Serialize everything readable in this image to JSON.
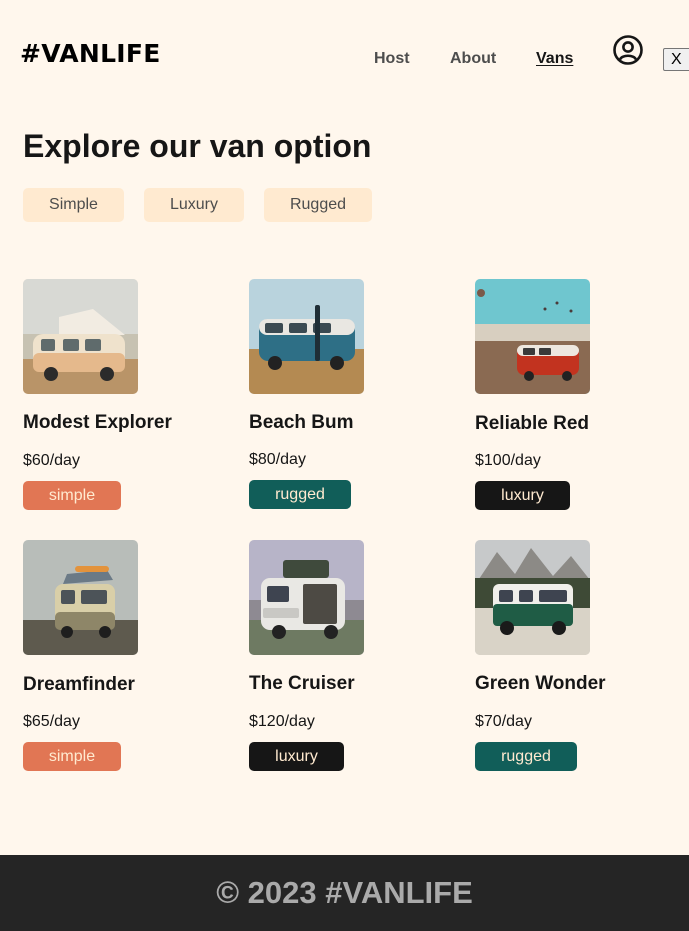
{
  "header": {
    "logo": "#VANLIFE",
    "nav": {
      "host": "Host",
      "about": "About",
      "vans": "Vans"
    },
    "close_label": "X"
  },
  "main": {
    "title": "Explore our van option",
    "filters": [
      "Simple",
      "Luxury",
      "Rugged"
    ],
    "vans": [
      {
        "name": "Modest Explorer",
        "price": "$60/day",
        "type": "simple"
      },
      {
        "name": "Beach Bum",
        "price": "$80/day",
        "type": "rugged"
      },
      {
        "name": "Reliable Red",
        "price": "$100/day",
        "type": "luxury"
      },
      {
        "name": "Dreamfinder",
        "price": "$65/day",
        "type": "simple"
      },
      {
        "name": "The Cruiser",
        "price": "$120/day",
        "type": "luxury"
      },
      {
        "name": "Green Wonder",
        "price": "$70/day",
        "type": "rugged"
      }
    ]
  },
  "footer": {
    "text": "© 2023 #VANLIFE"
  },
  "colors": {
    "background": "#FFF7ED",
    "filter_bg": "#FFEAD0",
    "simple": "#E17654",
    "rugged": "#115E59",
    "luxury": "#161616",
    "footer_bg": "#252525"
  },
  "icons": {
    "avatar": "user-circle-icon"
  }
}
